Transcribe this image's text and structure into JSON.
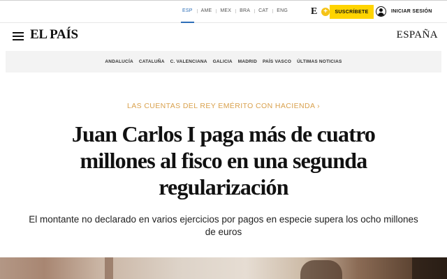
{
  "editions": [
    "ESP",
    "AME",
    "MEX",
    "BRA",
    "CAT",
    "ENG"
  ],
  "active_edition": "ESP",
  "header": {
    "e_logo": "E",
    "plus": "+",
    "subscribe_label": "SUSCRÍBETE",
    "login_label": "INICIAR SESIÓN"
  },
  "masthead": {
    "logo": "EL PAÍS",
    "edition_name": "ESPAÑA"
  },
  "regions": [
    "ANDALUCÍA",
    "CATALUÑA",
    "C. VALENCIANA",
    "GALICIA",
    "MADRID",
    "PAÍS VASCO",
    "ÚLTIMAS NOTICIAS"
  ],
  "article": {
    "kicker": "LAS CUENTAS DEL REY EMÉRITO CON HACIENDA",
    "kicker_arrow": "›",
    "headline": "Juan Carlos I paga más de cuatro millones al fisco en una segunda regularización",
    "subhead": "El montante no declarado en varios ejercicios por pagos en especie supera los ocho millones de euros"
  },
  "colors": {
    "accent_blue": "#2e6fb8",
    "subscribe_yellow": "#ffd400",
    "kicker_gold": "#d9a14d",
    "region_bg": "#f3f3f3"
  },
  "icons": {
    "menu": "hamburger-icon",
    "user": "user-icon",
    "kicker": "chevron-right-icon"
  }
}
